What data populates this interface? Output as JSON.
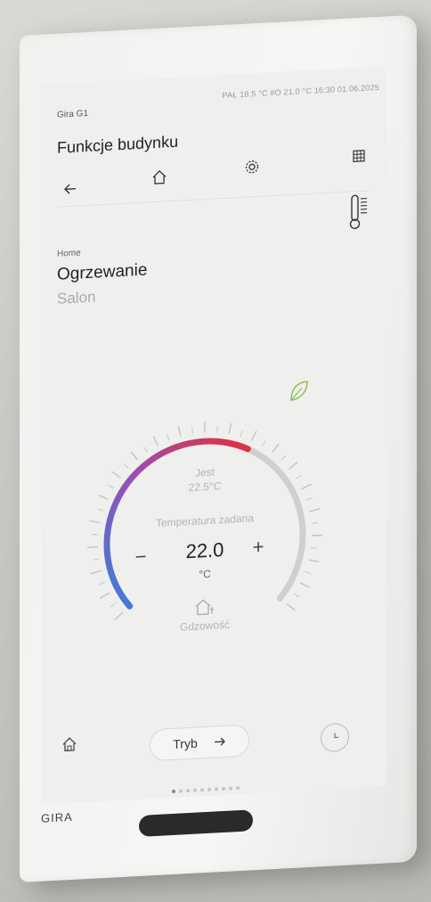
{
  "header": {
    "brand": "Gira G1",
    "status": "PAŁ 18.5 °C #O 21.0 °C 16:30 01.06.2025",
    "title": "Funkcje budynku"
  },
  "nav": {
    "back_icon": "arrow-left-icon",
    "home_icon": "home-icon",
    "settings_icon": "gear-icon",
    "grid_icon": "grid-icon"
  },
  "side_icon": "thermometer-icon",
  "content": {
    "breadcrumb": "Home",
    "heading": "Ogrzewanie",
    "subheading": "Salon"
  },
  "leaf_icon": "leaf-icon",
  "gauge": {
    "current_label": "Jest",
    "current_value": "22.5°C",
    "setpoint_label": "Temperatura zadana",
    "setpoint_value": "22.0",
    "unit": "°C",
    "minus": "−",
    "plus": "+",
    "presence_label": "Gdzowość",
    "presence_icon": "home-person-icon",
    "min": 10,
    "max": 30,
    "fill_to": 22.0,
    "colors": {
      "cold": "#3a7fd8",
      "mid": "#9a4fb0",
      "hot": "#e0303d",
      "rest": "#cfcfcf"
    }
  },
  "footer": {
    "home_icon": "home-icon",
    "mode_label": "Tryb",
    "mode_icon": "arrow-right-icon",
    "clock_icon": "clock-icon",
    "pages": 10,
    "active_page": 0
  },
  "device": {
    "logo": "GIRA"
  }
}
